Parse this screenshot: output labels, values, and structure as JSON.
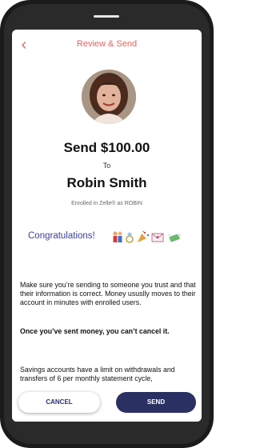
{
  "header": {
    "title": "Review & Send",
    "back_icon": "chevron-left-icon"
  },
  "recipient": {
    "send_line": "Send $100.00",
    "to_label": "To",
    "name": "Robin Smith",
    "enrolled_text": "Enrolled in Zelle® as ROBIN"
  },
  "memo": {
    "text": "Congratulations!",
    "emojis": [
      "people-icon",
      "ring-icon",
      "party-popper-icon",
      "envelope-heart-icon",
      "money-wings-icon"
    ]
  },
  "info": {
    "paragraph": "Make sure you’re sending to someone you trust and that their information is correct. Money ususlly moves to their account in minutes with enrolled users.",
    "warning": "Once you’ve sent money, you can’t cancel it.",
    "savings_note": "Savings accounts have a limit on withdrawals and transfers of 6 per monthly statement cycle,"
  },
  "actions": {
    "cancel_label": "CANCEL",
    "send_label": "SEND"
  },
  "colors": {
    "accent": "#e2645c",
    "brand_navy": "#2b3063",
    "memo_blue": "#3b3f96"
  }
}
